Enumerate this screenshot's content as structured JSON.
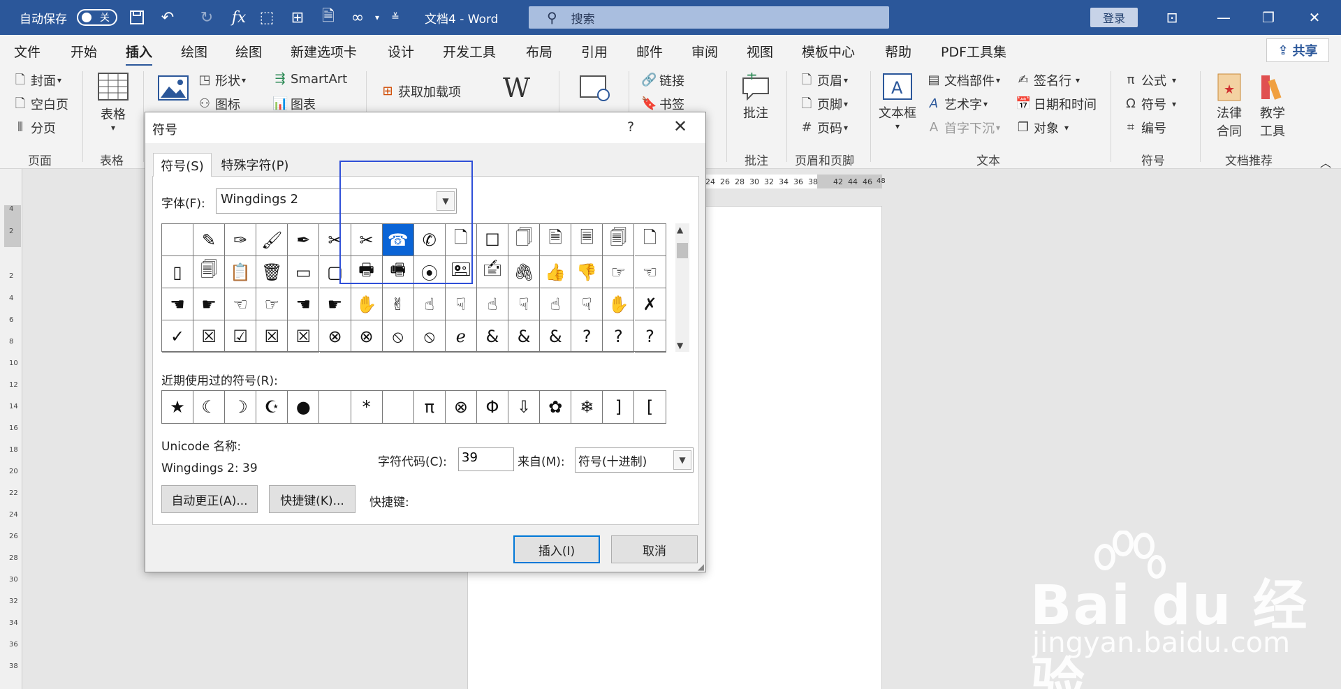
{
  "titlebar": {
    "autosave_label": "自动保存",
    "autosave_state": "关",
    "doc_title": "文档4  -  Word",
    "search_placeholder": "搜索",
    "login_label": "登录",
    "undo_icon": "undo-icon",
    "save_icon": "save-icon"
  },
  "tabs": [
    {
      "label": "文件"
    },
    {
      "label": "开始"
    },
    {
      "label": "插入"
    },
    {
      "label": "绘图"
    },
    {
      "label": "绘图"
    },
    {
      "label": "新建选项卡"
    },
    {
      "label": "设计"
    },
    {
      "label": "开发工具"
    },
    {
      "label": "布局"
    },
    {
      "label": "引用"
    },
    {
      "label": "邮件"
    },
    {
      "label": "审阅"
    },
    {
      "label": "视图"
    },
    {
      "label": "模板中心"
    },
    {
      "label": "帮助"
    },
    {
      "label": "PDF工具集"
    }
  ],
  "share_label": "共享",
  "ribbon": {
    "pages": {
      "cover": "封面",
      "blank": "空白页",
      "break": "分页",
      "group": "页面"
    },
    "table": {
      "label": "表格",
      "group": "表格"
    },
    "illus": {
      "shape": "形状",
      "icon": "图标",
      "smartart": "SmartArt",
      "chart": "图表"
    },
    "addins": {
      "get": "获取加载项"
    },
    "links": {
      "link": "链接",
      "bookmark": "书签"
    },
    "comment": {
      "label": "批注",
      "group": "批注"
    },
    "header_footer": {
      "header": "页眉",
      "footer": "页脚",
      "page_num": "页码",
      "group": "页眉和页脚"
    },
    "text": {
      "textbox": "文本框",
      "parts": "文档部件",
      "wordart": "艺术字",
      "dropcap": "首字下沉",
      "signature": "签名行",
      "datetime": "日期和时间",
      "object": "对象",
      "group": "文本"
    },
    "symbols": {
      "equation": "公式",
      "symbol": "符号",
      "number": "编号",
      "group": "符号"
    },
    "recommend": {
      "law": "法律合同",
      "law1": "法律",
      "law2": "合同",
      "edu1": "教学",
      "edu2": "工具",
      "group": "文档推荐"
    }
  },
  "ruler": {
    "h_numbers": [
      "24",
      "26",
      "28",
      "30",
      "32",
      "34",
      "36",
      "38",
      "42",
      "44",
      "46",
      "48"
    ],
    "v_numbers": [
      "4",
      "2",
      "2",
      "4",
      "6",
      "8",
      "10",
      "12",
      "14",
      "16",
      "18",
      "20",
      "22",
      "24",
      "26",
      "28",
      "30",
      "32",
      "34",
      "36",
      "38"
    ]
  },
  "dialog": {
    "title": "符号",
    "help": "?",
    "close": "✕",
    "tab_symbols": "符号(S)",
    "tab_special": "特殊字符(P)",
    "font_label": "字体(F):",
    "font_value": "Wingdings 2",
    "grid": [
      [
        "",
        "✎",
        "✑",
        "🖌",
        "✒",
        "✂",
        "✂",
        "☎",
        "✆",
        "🗋",
        "☐",
        "🗍",
        "🗎",
        "🗏",
        "🗐",
        "🗋"
      ],
      [
        "▯",
        "🗐",
        "📋",
        "🗑",
        "▭",
        "▢",
        "🖶",
        "🖷",
        "⦿",
        "🖭",
        "🖆",
        "🖇",
        "👍",
        "👎",
        "☞",
        "☜"
      ],
      [
        "☚",
        "☛",
        "☜",
        "☞",
        "☚",
        "☛",
        "✋",
        "✌",
        "☝",
        "☟",
        "☝",
        "☟",
        "☝",
        "☟",
        "✋",
        "✗"
      ],
      [
        "✓",
        "☒",
        "☑",
        "☒",
        "☒",
        "⊗",
        "⊗",
        "⦸",
        "⦸",
        "ℯ",
        "&",
        "&",
        "&",
        "?",
        "?",
        "?"
      ]
    ],
    "selected_index": 7,
    "recent_label": "近期使用过的符号(R):",
    "recent": [
      "★",
      "☾",
      "☽",
      "☪",
      "●",
      "",
      "*",
      "",
      "π",
      "⊗",
      "Φ",
      "⇩",
      "✿",
      "❄",
      "]",
      "["
    ],
    "unicode_label": "Unicode 名称:",
    "unicode_value": "Wingdings 2: 39",
    "code_label": "字符代码(C):",
    "code_value": "39",
    "from_label": "来自(M):",
    "from_value": "符号(十进制)",
    "autocorrect_label": "自动更正(A)...",
    "shortcut_label": "快捷键(K)...",
    "shortcut_key_label": "快捷键:",
    "insert_label": "插入(I)",
    "cancel_label": "取消"
  },
  "watermark": {
    "title": "Bai du 经验",
    "sub": "jingyan.baidu.com"
  },
  "colors": {
    "titlebar": "#2b579a",
    "selection": "#0a64d6",
    "annotation": "#2f4fd8"
  }
}
